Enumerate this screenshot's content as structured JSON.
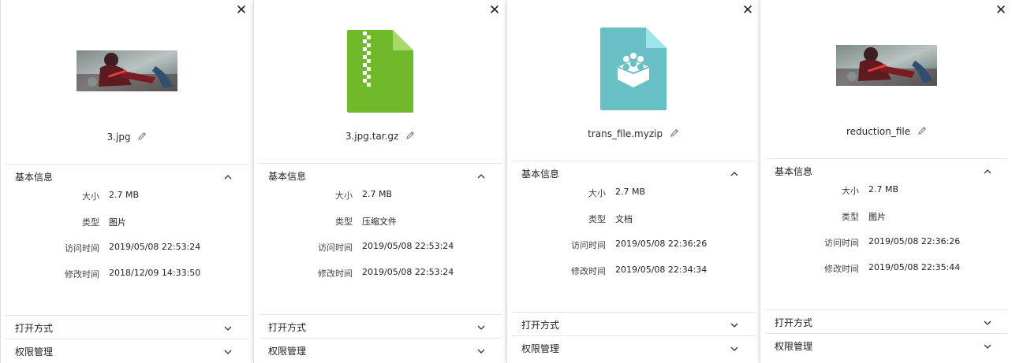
{
  "panels": [
    {
      "filename": "3.jpg",
      "preview": "image",
      "section_basic": "基本信息",
      "labels": {
        "size": "大小",
        "type": "类型",
        "accessed": "访问时间",
        "modified": "修改时间"
      },
      "size": "2.7 MB",
      "type": "图片",
      "accessed": "2019/05/08 22:53:24",
      "modified": "2018/12/09 14:33:50",
      "section_open": "打开方式",
      "section_perm": "权限管理"
    },
    {
      "filename": "3.jpg.tar.gz",
      "preview": "archive",
      "section_basic": "基本信息",
      "labels": {
        "size": "大小",
        "type": "类型",
        "accessed": "访问时间",
        "modified": "修改时间"
      },
      "size": "2.7 MB",
      "type": "压缩文件",
      "accessed": "2019/05/08 22:53:24",
      "modified": "2019/05/08 22:53:24",
      "section_open": "打开方式",
      "section_perm": "权限管理"
    },
    {
      "filename": "trans_file.myzip",
      "preview": "document",
      "section_basic": "基本信息",
      "labels": {
        "size": "大小",
        "type": "类型",
        "accessed": "访问时间",
        "modified": "修改时间"
      },
      "size": "2.7 MB",
      "type": "文档",
      "accessed": "2019/05/08 22:36:26",
      "modified": "2019/05/08 22:34:34",
      "section_open": "打开方式",
      "section_perm": "权限管理"
    },
    {
      "filename": "reduction_file",
      "preview": "image",
      "section_basic": "基本信息",
      "labels": {
        "size": "大小",
        "type": "类型",
        "accessed": "访问时间",
        "modified": "修改时间"
      },
      "size": "2.7 MB",
      "type": "图片",
      "accessed": "2019/05/08 22:36:26",
      "modified": "2019/05/08 22:35:44",
      "section_open": "打开方式",
      "section_perm": "权限管理"
    }
  ],
  "icons": {
    "close": "close-icon",
    "edit": "pencil-icon",
    "expanded": "chevron-up-icon",
    "collapsed": "chevron-down-icon"
  },
  "colors": {
    "archive_green": "#6fb92a",
    "document_teal": "#68bfc4"
  }
}
